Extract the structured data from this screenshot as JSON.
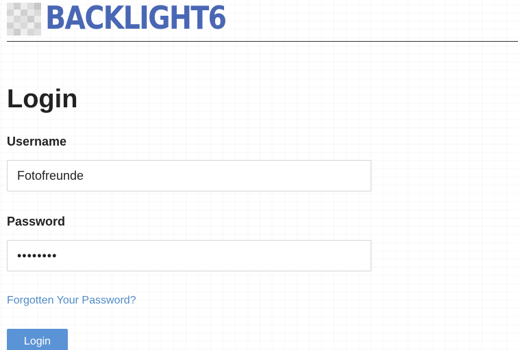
{
  "brand": {
    "logo_text": "BACKLIGHT6",
    "logo_icon": "pixel-mosaic-icon",
    "accent_color": "#4a67b5"
  },
  "page": {
    "title": "Login"
  },
  "form": {
    "username": {
      "label": "Username",
      "value": "Fotofreunde"
    },
    "password": {
      "label": "Password",
      "value": "password"
    },
    "forgot_link": "Forgotten Your Password?",
    "submit_label": "Login",
    "button_color": "#5b94d6",
    "link_color": "#4e8ac7"
  }
}
